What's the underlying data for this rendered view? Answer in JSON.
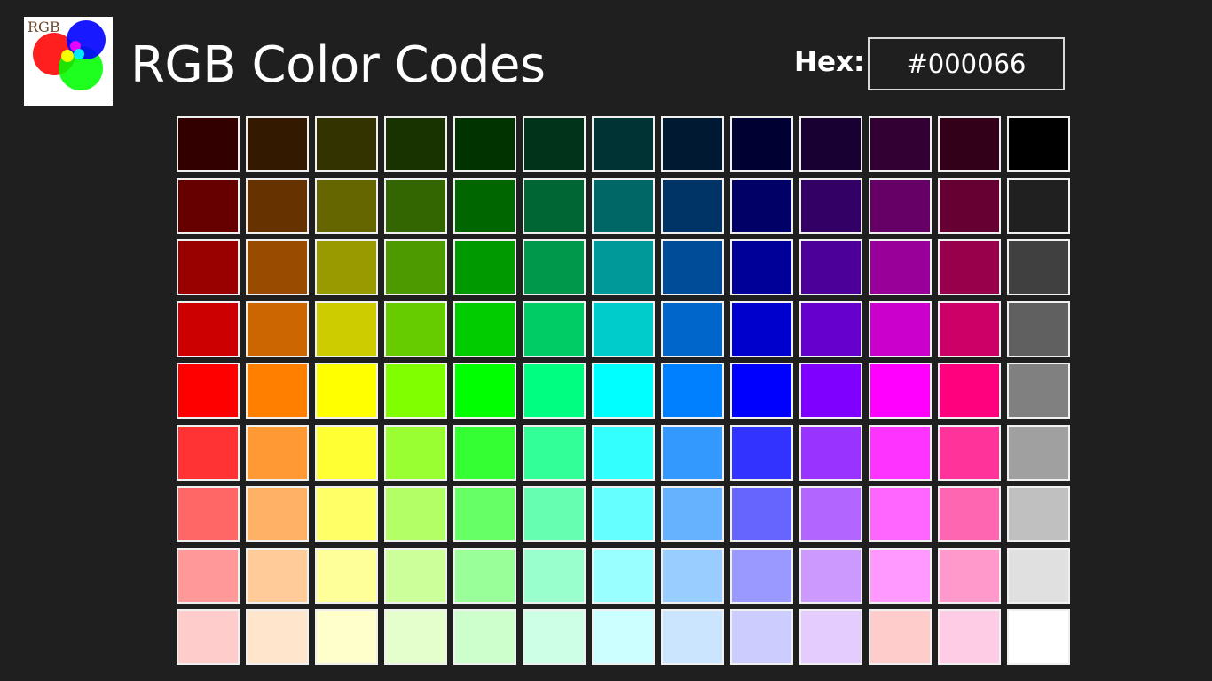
{
  "app": {
    "title": "RGB Color Codes",
    "logo_text": "RGB"
  },
  "hex": {
    "label": "Hex:",
    "value": "#000066"
  },
  "palette": {
    "rows": [
      [
        "#330000",
        "#331900",
        "#333300",
        "#193300",
        "#003300",
        "#003319",
        "#003333",
        "#001933",
        "#000033",
        "#190033",
        "#330033",
        "#330019",
        "#000000"
      ],
      [
        "#660000",
        "#663300",
        "#666600",
        "#336600",
        "#006600",
        "#006633",
        "#006666",
        "#003366",
        "#000066",
        "#330066",
        "#660066",
        "#660033",
        "#202020"
      ],
      [
        "#990000",
        "#994C00",
        "#999900",
        "#4C9900",
        "#009900",
        "#00994C",
        "#009999",
        "#004C99",
        "#000099",
        "#4C0099",
        "#990099",
        "#99004C",
        "#404040"
      ],
      [
        "#CC0000",
        "#CC6600",
        "#CCCC00",
        "#66CC00",
        "#00CC00",
        "#00CC66",
        "#00CCCC",
        "#0066CC",
        "#0000CC",
        "#6600CC",
        "#CC00CC",
        "#CC0066",
        "#606060"
      ],
      [
        "#FF0000",
        "#FF8000",
        "#FFFF00",
        "#80FF00",
        "#00FF00",
        "#00FF80",
        "#00FFFF",
        "#0080FF",
        "#0000FF",
        "#7F00FF",
        "#FF00FF",
        "#FF007F",
        "#808080"
      ],
      [
        "#FF3333",
        "#FF9933",
        "#FFFF33",
        "#99FF33",
        "#33FF33",
        "#33FF99",
        "#33FFFF",
        "#3399FF",
        "#3333FF",
        "#9933FF",
        "#FF33FF",
        "#FF3399",
        "#A0A0A0"
      ],
      [
        "#FF6666",
        "#FFB266",
        "#FFFF66",
        "#B2FF66",
        "#66FF66",
        "#66FFB2",
        "#66FFFF",
        "#66B2FF",
        "#6666FF",
        "#B266FF",
        "#FF66FF",
        "#FF66B2",
        "#C0C0C0"
      ],
      [
        "#FF9999",
        "#FFCC99",
        "#FFFF99",
        "#CCFF99",
        "#99FF99",
        "#99FFCC",
        "#99FFFF",
        "#99CCFF",
        "#9999FF",
        "#CC99FF",
        "#FF99FF",
        "#FF99CC",
        "#E0E0E0"
      ],
      [
        "#FFCCCC",
        "#FFE5CC",
        "#FFFFCC",
        "#E5FFCC",
        "#CCFFCC",
        "#CCFFE5",
        "#CCFFFF",
        "#CCE5FF",
        "#CCCCFF",
        "#E5CCFF",
        "#FFCCCC",
        "#FFCCE5",
        "#FFFFFF"
      ]
    ]
  }
}
